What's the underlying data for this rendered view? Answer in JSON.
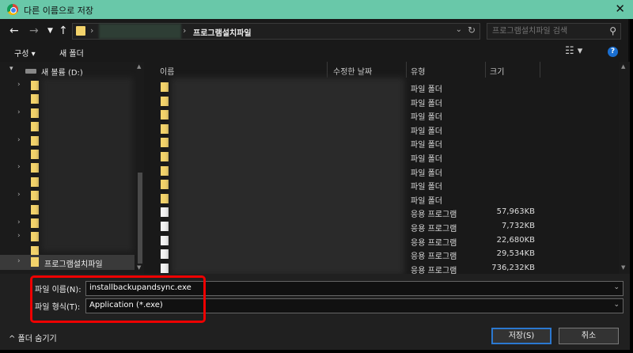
{
  "window": {
    "title": "다른 이름으로 저장",
    "close": "✕"
  },
  "address": {
    "current_folder": "프로그램설치파일",
    "search_placeholder": "프로그램설치파일 검색"
  },
  "toolbar": {
    "organize": "구성 ▾",
    "new_folder": "새 폴더"
  },
  "nav": {
    "drive": "새 볼륨 (D:)",
    "selected": "프로그램설치파일",
    "folder_count": 13
  },
  "columns": {
    "name": "이름",
    "date": "수정한 날짜",
    "type": "유형",
    "size": "크기"
  },
  "files": [
    {
      "type": "파일 폴더",
      "size": "",
      "icon": "folder"
    },
    {
      "type": "파일 폴더",
      "size": "",
      "icon": "folder"
    },
    {
      "type": "파일 폴더",
      "size": "",
      "icon": "folder"
    },
    {
      "type": "파일 폴더",
      "size": "",
      "icon": "folder"
    },
    {
      "type": "파일 폴더",
      "size": "",
      "icon": "folder"
    },
    {
      "type": "파일 폴더",
      "size": "",
      "icon": "folder"
    },
    {
      "type": "파일 폴더",
      "size": "",
      "icon": "folder"
    },
    {
      "type": "파일 폴더",
      "size": "",
      "icon": "folder"
    },
    {
      "type": "파일 폴더",
      "size": "",
      "icon": "folder"
    },
    {
      "type": "응용 프로그램",
      "size": "57,963KB",
      "icon": "app"
    },
    {
      "type": "응용 프로그램",
      "size": "7,732KB",
      "icon": "app"
    },
    {
      "type": "응용 프로그램",
      "size": "22,680KB",
      "icon": "app"
    },
    {
      "type": "응용 프로그램",
      "size": "29,534KB",
      "icon": "app"
    },
    {
      "type": "응용 프로그램",
      "size": "736,232KB",
      "icon": "app"
    }
  ],
  "form": {
    "filename_label": "파일 이름(N):",
    "filename_value": "installbackupandsync.exe",
    "filetype_label": "파일 형식(T):",
    "filetype_value": "Application (*.exe)"
  },
  "footer": {
    "hide_folders": "^  폴더 숨기기",
    "save": "저장(S)",
    "cancel": "취소"
  },
  "colors": {
    "titlebar": "#69c8a9",
    "highlight": "#ee0000",
    "folder": "#f3d36b",
    "accent": "#2b78d0"
  }
}
